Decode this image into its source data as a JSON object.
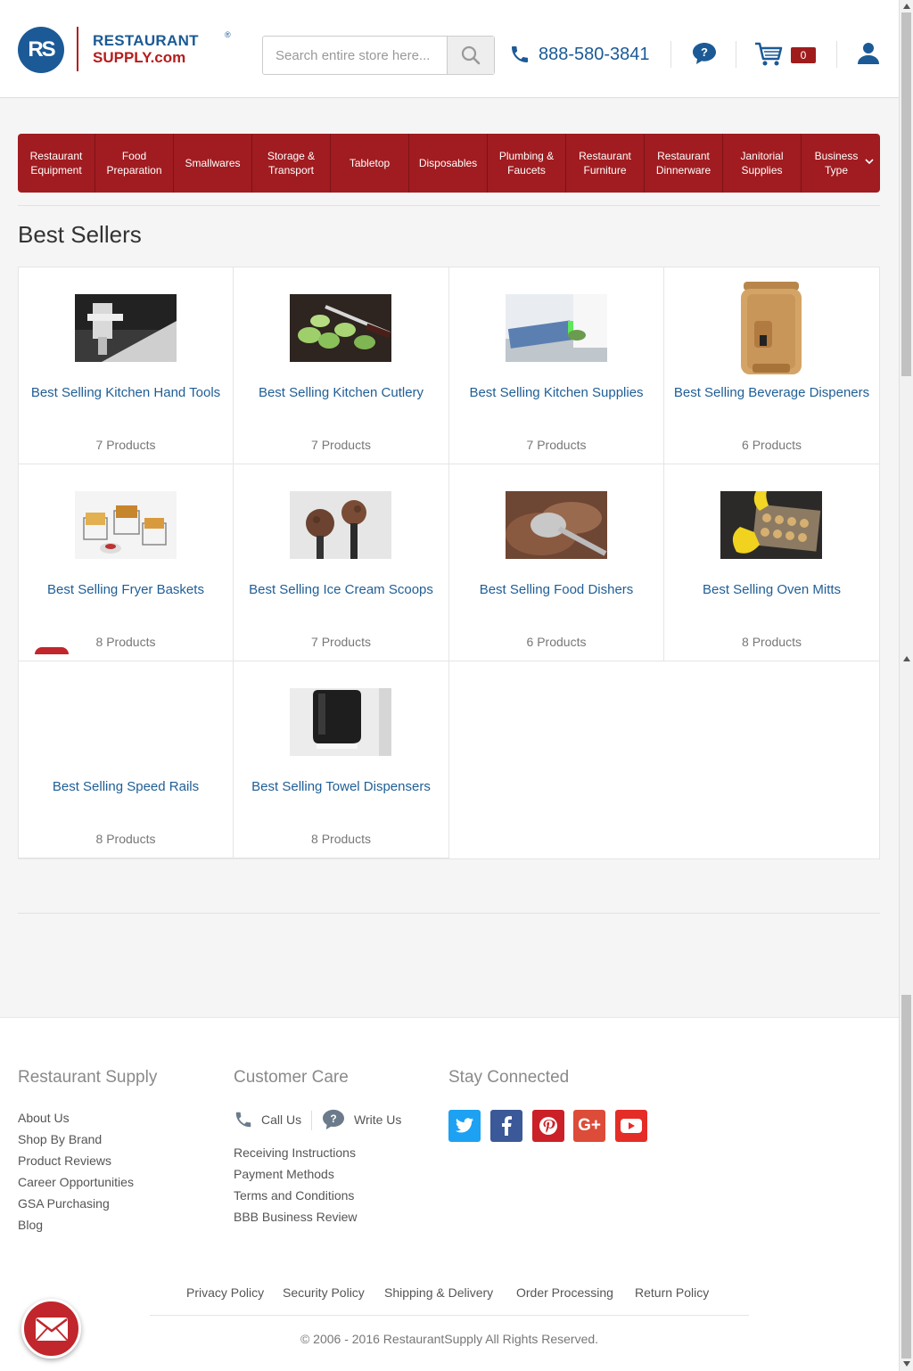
{
  "header": {
    "logo_mark": "RS",
    "logo_line1": "RESTAURANT",
    "logo_reg": "®",
    "logo_line2": "SUPPLY.com",
    "search_placeholder": "Search entire store here...",
    "phone": "888-580-3841",
    "cart_count": "0"
  },
  "nav": {
    "items": [
      {
        "label": "Restaurant Equipment"
      },
      {
        "label": "Food Preparation"
      },
      {
        "label": "Smallwares"
      },
      {
        "label": "Storage & Transport"
      },
      {
        "label": "Tabletop"
      },
      {
        "label": "Disposables"
      },
      {
        "label": "Plumbing & Faucets"
      },
      {
        "label": "Restaurant Furniture"
      },
      {
        "label": "Restaurant Dinnerware"
      },
      {
        "label": "Janitorial Supplies"
      },
      {
        "label": "Business Type"
      }
    ]
  },
  "page": {
    "title": "Best Sellers"
  },
  "categories": [
    {
      "name": "Best Selling Kitchen Hand Tools",
      "count": "7 Products"
    },
    {
      "name": "Best Selling Kitchen Cutlery",
      "count": "7 Products"
    },
    {
      "name": "Best Selling Kitchen Supplies",
      "count": "7 Products"
    },
    {
      "name": "Best Selling Beverage Dispeners",
      "count": "6 Products"
    },
    {
      "name": "Best Selling Fryer Baskets",
      "count": "8 Products"
    },
    {
      "name": "Best Selling Ice Cream Scoops",
      "count": "7 Products"
    },
    {
      "name": "Best Selling Food Dishers",
      "count": "6 Products"
    },
    {
      "name": "Best Selling Oven Mitts",
      "count": "8 Products"
    },
    {
      "name": "Best Selling Speed Rails",
      "count": "8 Products"
    },
    {
      "name": "Best Selling Towel Dispensers",
      "count": "8 Products"
    }
  ],
  "footer": {
    "col1_title": "Restaurant Supply",
    "col1_links": [
      "About Us",
      "Shop By Brand",
      "Product Reviews",
      "Career Opportunities",
      "GSA Purchasing",
      "Blog"
    ],
    "col2_title": "Customer Care",
    "call_us": "Call Us",
    "write_us": "Write Us",
    "col2_links": [
      "Receiving Instructions",
      "Payment Methods",
      "Terms and Conditions",
      "BBB Business Review"
    ],
    "col3_title": "Stay Connected",
    "social": [
      {
        "icon": "twitter-icon",
        "color": "#1da1f2"
      },
      {
        "icon": "facebook-icon",
        "color": "#3b5998"
      },
      {
        "icon": "pinterest-icon",
        "color": "#cb2027"
      },
      {
        "icon": "google-plus-icon",
        "color": "#dd4b39"
      },
      {
        "icon": "youtube-icon",
        "color": "#e52d27"
      }
    ],
    "policies": [
      "Privacy Policy",
      "Security Policy",
      "Shipping & Delivery",
      "Order Processing",
      "Return Policy"
    ],
    "copyright": "© 2006 - 2016 RestaurantSupply All Rights Reserved."
  },
  "colors": {
    "brand_blue": "#1b5a96",
    "brand_red": "#a01c20",
    "link": "#1f5e96"
  }
}
